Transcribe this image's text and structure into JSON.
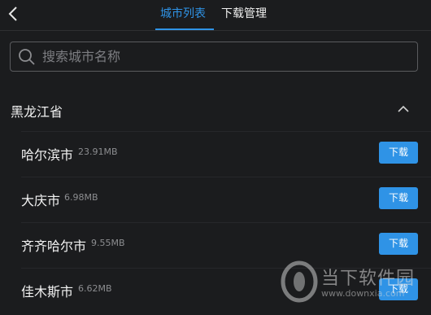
{
  "header": {
    "tabs": [
      {
        "label": "城市列表",
        "active": true
      },
      {
        "label": "下载管理",
        "active": false
      }
    ]
  },
  "search": {
    "placeholder": "搜索城市名称",
    "value": ""
  },
  "province": {
    "name": "黑龙江省",
    "expanded": true
  },
  "cities": [
    {
      "name": "哈尔滨市",
      "size": "23.91MB",
      "button": "下载"
    },
    {
      "name": "大庆市",
      "size": "6.98MB",
      "button": "下载"
    },
    {
      "name": "齐齐哈尔市",
      "size": "9.55MB",
      "button": "下载"
    },
    {
      "name": "佳木斯市",
      "size": "6.62MB",
      "button": "下载"
    }
  ],
  "watermark": {
    "text": "当下软件园",
    "url": "www.downxia.com"
  },
  "colors": {
    "accent": "#2f93e6",
    "background": "#1b1c1e"
  }
}
